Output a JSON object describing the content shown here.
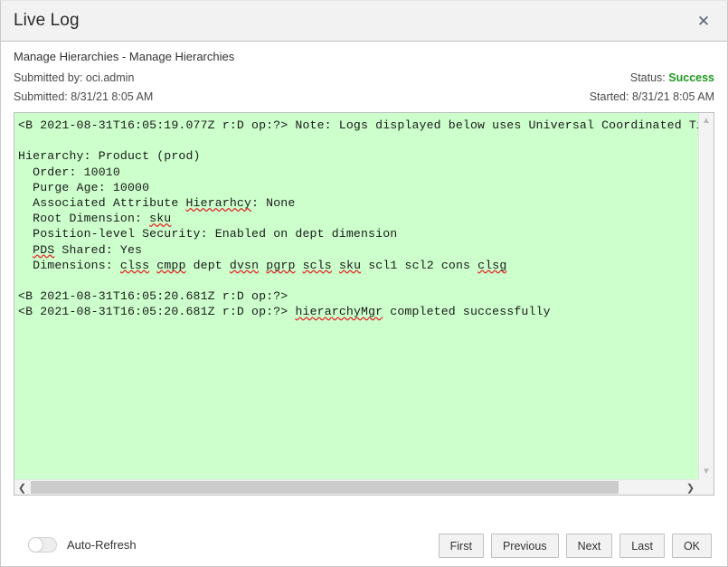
{
  "dialog": {
    "title": "Live Log",
    "close_icon": "close-icon"
  },
  "meta": {
    "job_name": "Manage Hierarchies - Manage Hierarchies",
    "submitted_by": "Submitted by: oci.admin",
    "submitted_at": "Submitted: 8/31/21 8:05 AM",
    "status_label": "Status:",
    "status_value": "Success",
    "status_color": "#1f9a1f",
    "started_at": "Started: 8/31/21 8:05 AM"
  },
  "log": {
    "background_color": "#ccffcc",
    "lines": [
      "<B 2021-08-31T16:05:19.077Z r:D op:?> Note: Logs displayed below uses Universal Coordinated Ti",
      "",
      "Hierarchy: Product (prod)",
      "  Order: 10010",
      "  Purge Age: 10000",
      "  Associated Attribute Hierarhcy: None",
      "  Root Dimension: sku",
      "  Position-level Security: Enabled on dept dimension",
      "  PDS Shared: Yes",
      "  Dimensions: clss cmpp dept dvsn pgrp scls sku scl1 scl2 cons clsg",
      "",
      "<B 2021-08-31T16:05:20.681Z r:D op:?>",
      "<B 2021-08-31T16:05:20.681Z r:D op:?> hierarchyMgr completed successfully"
    ],
    "misspelled_words": [
      "Hierarhcy",
      "sku",
      "PDS",
      "clss",
      "cmpp",
      "dvsn",
      "pgrp",
      "scls",
      "clsg",
      "hierarchyMgr"
    ],
    "vertical_scrollbar": {
      "up_arrow_icon": "chevron-up-icon",
      "down_arrow_icon": "chevron-down-icon"
    },
    "horizontal_scrollbar": {
      "left_arrow_icon": "chevron-left-icon",
      "right_arrow_icon": "chevron-right-icon"
    }
  },
  "footer": {
    "auto_refresh_label": "Auto-Refresh",
    "auto_refresh_on": false,
    "buttons": [
      {
        "label": "First"
      },
      {
        "label": "Previous"
      },
      {
        "label": "Next"
      },
      {
        "label": "Last"
      },
      {
        "label": "OK"
      }
    ]
  }
}
